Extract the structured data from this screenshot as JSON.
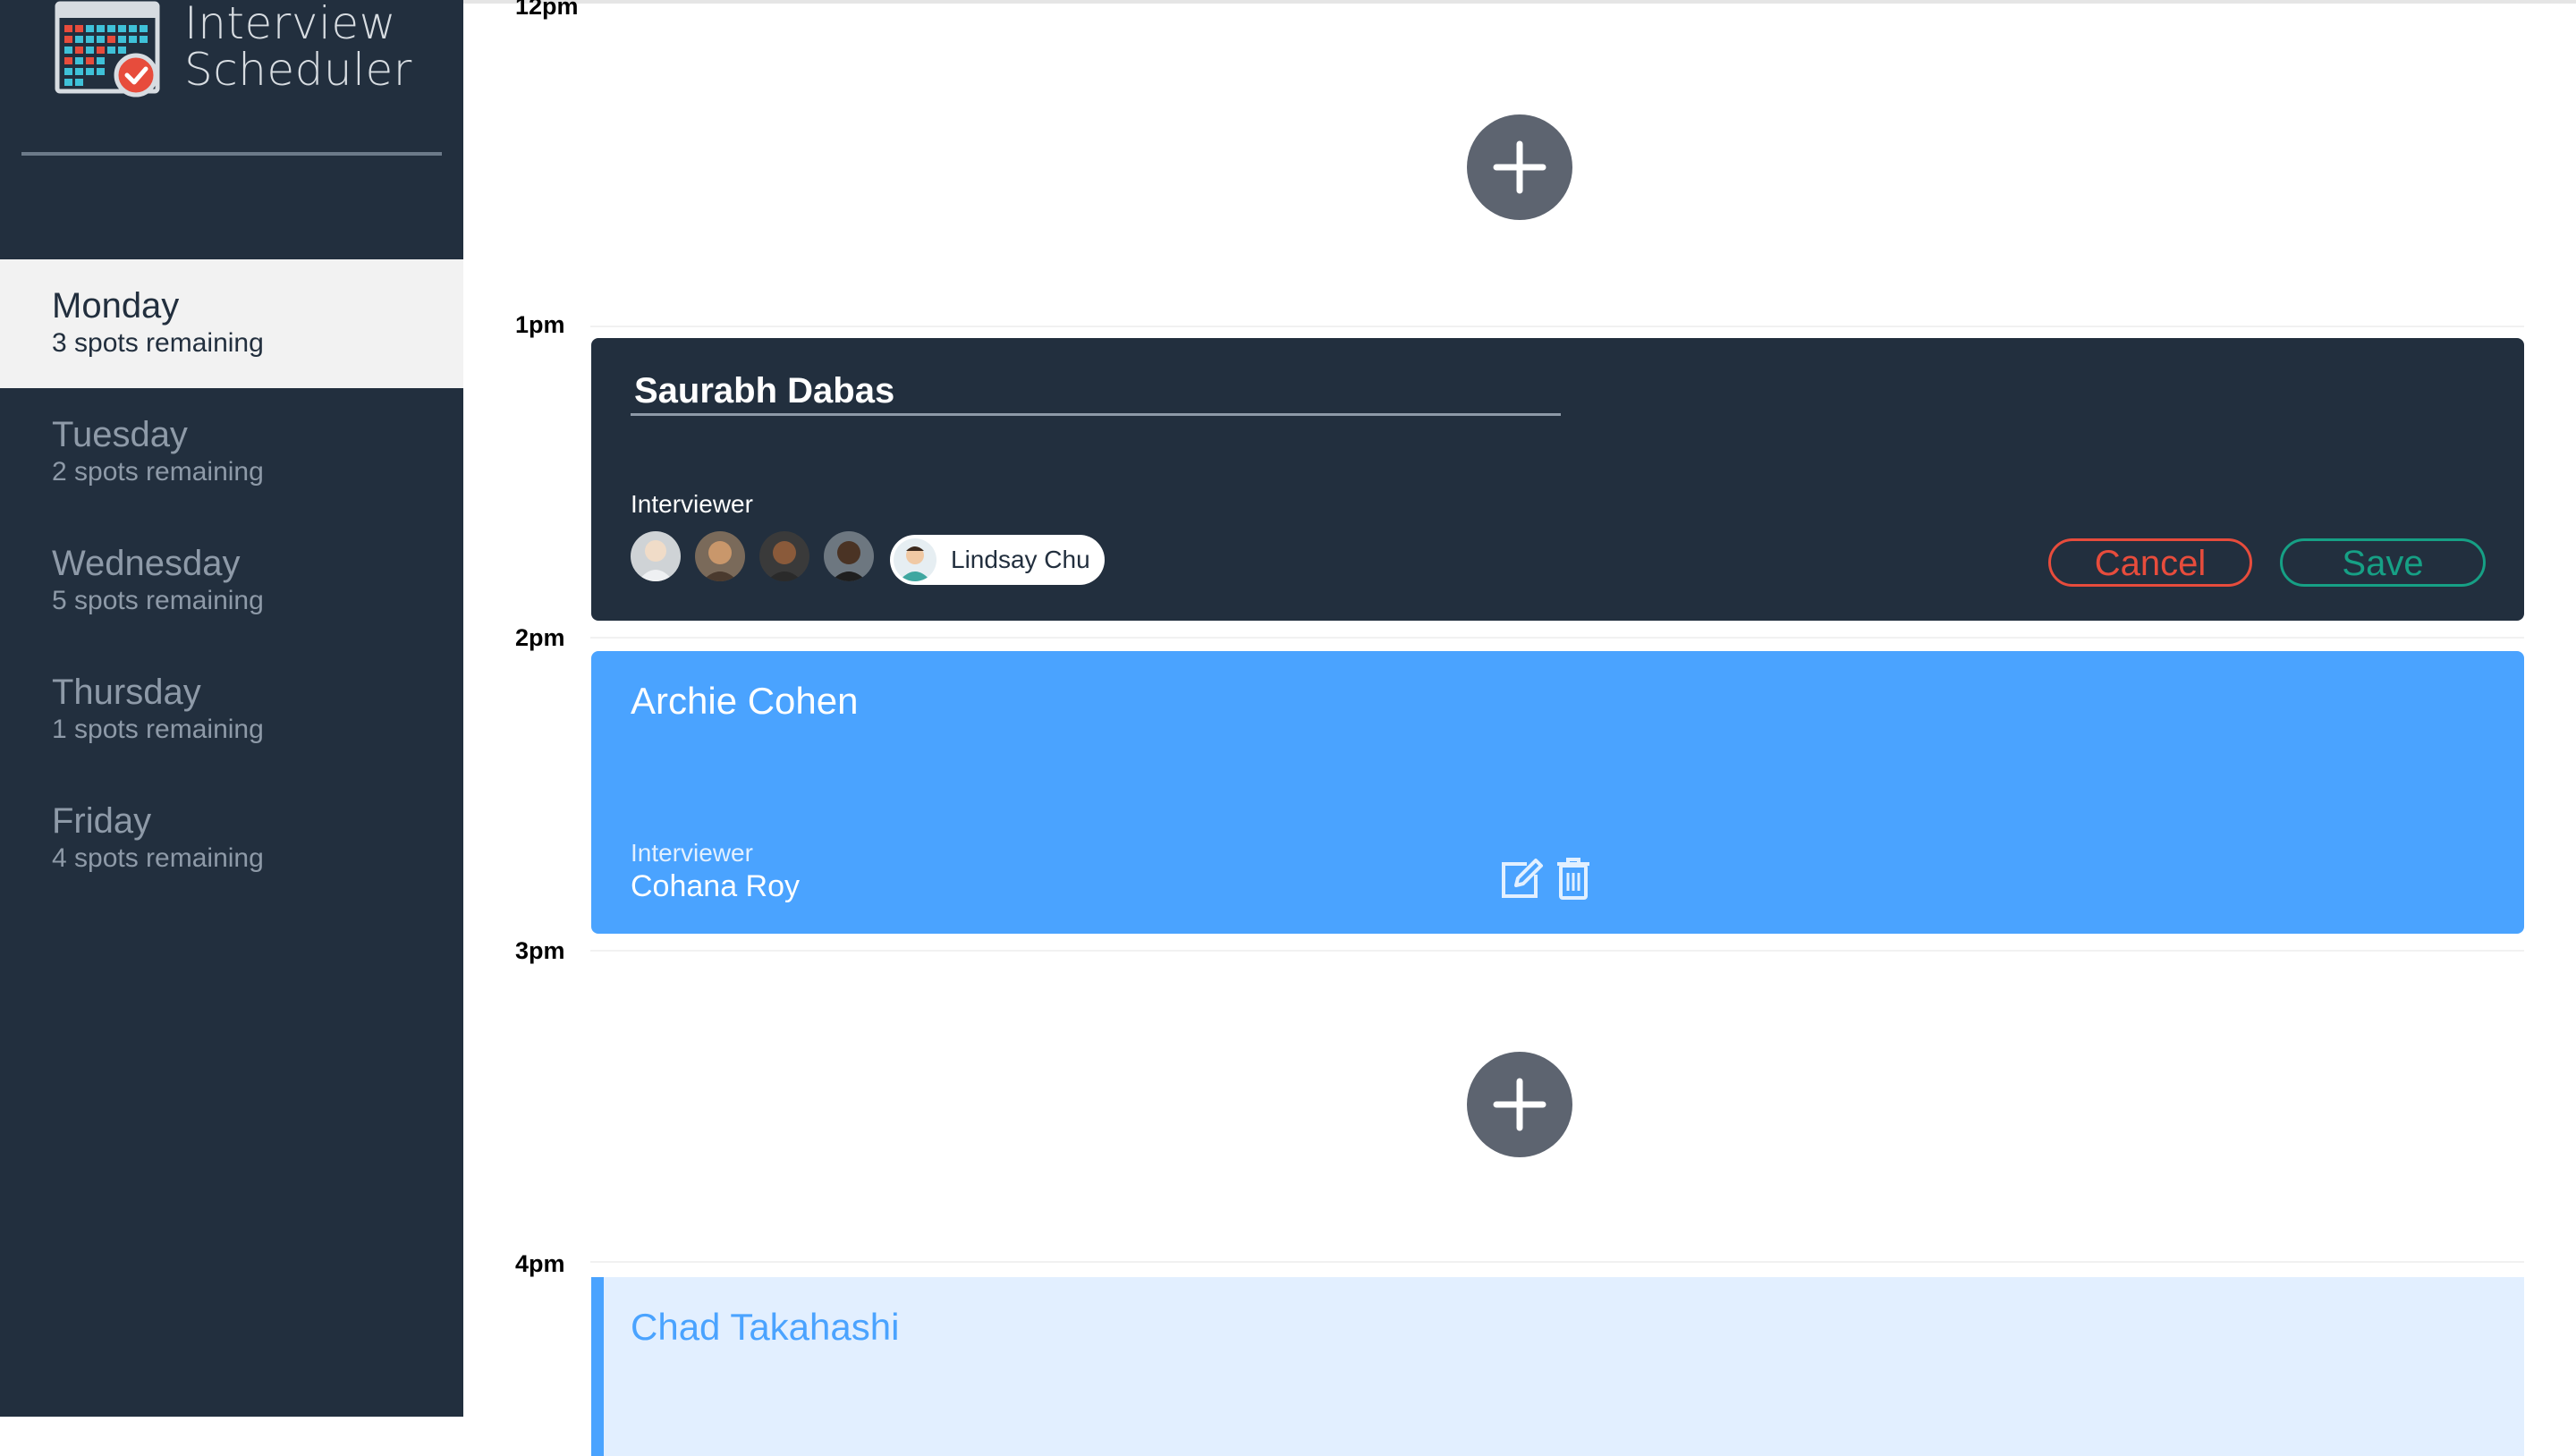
{
  "app": {
    "title_line1": "Interview",
    "title_line2": "Scheduler",
    "logo_icon": "calendar-check-icon"
  },
  "sidebar": {
    "days": [
      {
        "name": "Monday",
        "spots": "3 spots remaining",
        "selected": true
      },
      {
        "name": "Tuesday",
        "spots": "2 spots remaining",
        "selected": false
      },
      {
        "name": "Wednesday",
        "spots": "5 spots remaining",
        "selected": false
      },
      {
        "name": "Thursday",
        "spots": "1 spots remaining",
        "selected": false
      },
      {
        "name": "Friday",
        "spots": "4 spots remaining",
        "selected": false
      }
    ]
  },
  "schedule": {
    "times": [
      "12pm",
      "1pm",
      "2pm",
      "3pm",
      "4pm"
    ],
    "add_icon": "plus-icon",
    "form": {
      "student_value": "Saurabh Dabas",
      "interviewer_label": "Interviewer",
      "selected_interviewer": "Lindsay Chu",
      "cancel_label": "Cancel",
      "save_label": "Save"
    },
    "appointment": {
      "student": "Archie Cohen",
      "interviewer_label": "Interviewer",
      "interviewer": "Cohana Roy",
      "edit_icon": "edit-icon",
      "delete_icon": "trash-icon"
    },
    "preview": {
      "student": "Chad Takahashi"
    }
  },
  "colors": {
    "sidebar_bg": "#222f3e",
    "appointment_blue": "#4aa3ff",
    "cancel_red": "#e74c3c",
    "save_green": "#16a085",
    "add_button_gray": "#5d6470"
  }
}
